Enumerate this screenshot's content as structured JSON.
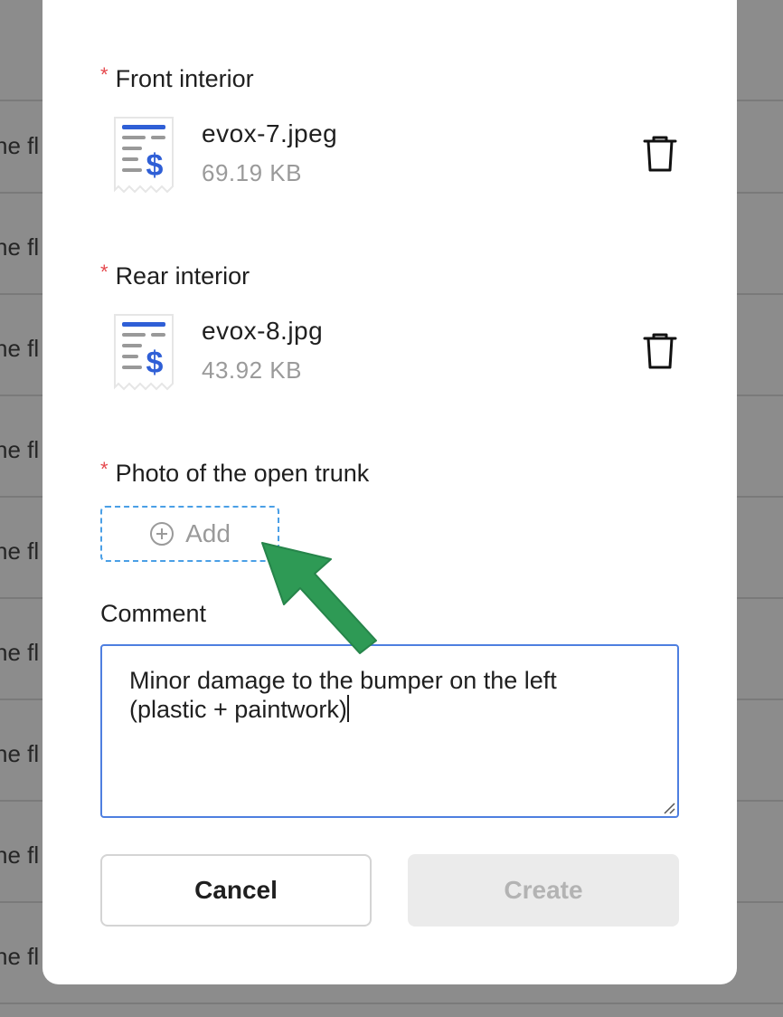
{
  "background": {
    "row_snippet": "ne fl"
  },
  "sections": [
    {
      "label": "Front interior",
      "file": {
        "name": "evox-7.jpeg",
        "size": "69.19 KB"
      }
    },
    {
      "label": "Rear interior",
      "file": {
        "name": "evox-8.jpg",
        "size": "43.92 KB"
      }
    },
    {
      "label": "Photo of the open trunk",
      "add_label": "Add"
    }
  ],
  "required_marker": "*",
  "comment": {
    "label": "Comment",
    "value": "Minor damage to the bumper on the left\n(plastic + paintwork)"
  },
  "buttons": {
    "cancel": "Cancel",
    "create": "Create"
  },
  "colors": {
    "accent_blue": "#4a9fe6",
    "required_red": "#e5484d",
    "arrow_green": "#2e9a55",
    "receipt_blue": "#2f5fd6"
  }
}
